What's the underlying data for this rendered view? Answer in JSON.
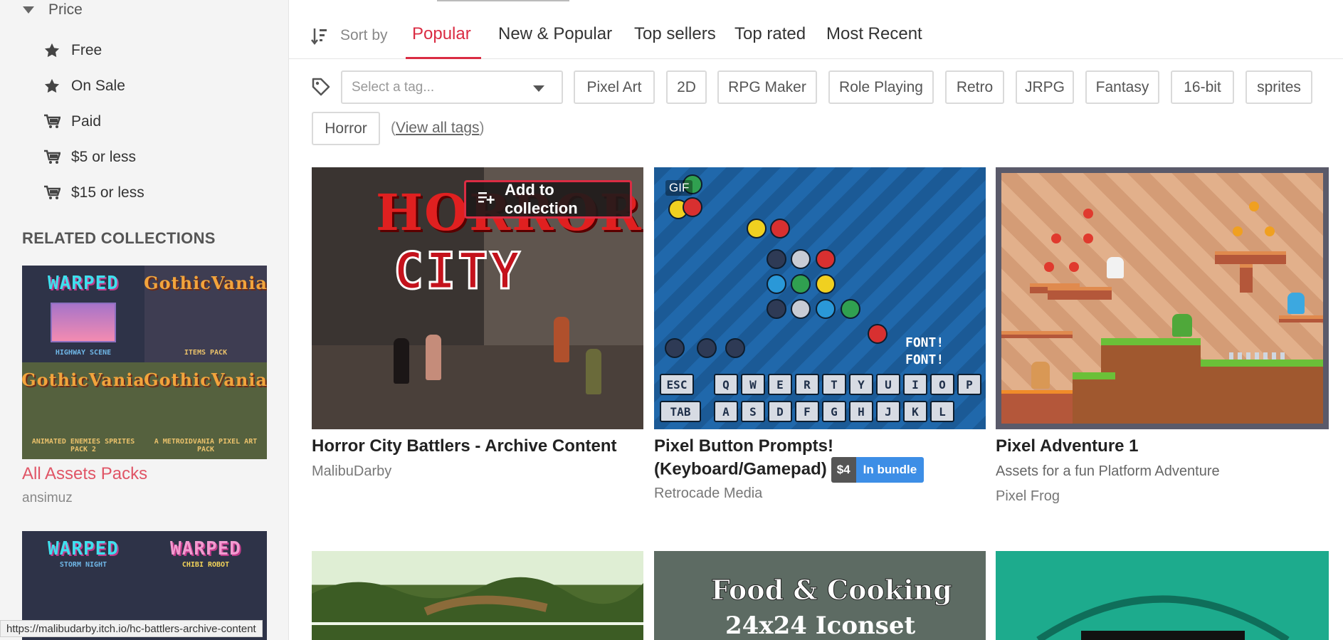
{
  "sidebar": {
    "price_heading": "Price",
    "price_filters": [
      {
        "label": "Free",
        "icon": "star-icon"
      },
      {
        "label": "On Sale",
        "icon": "star-icon"
      },
      {
        "label": "Paid",
        "icon": "cart-icon"
      },
      {
        "label": "$5 or less",
        "icon": "cart-icon"
      },
      {
        "label": "$15 or less",
        "icon": "cart-icon"
      }
    ],
    "related_heading": "RELATED COLLECTIONS",
    "collection": {
      "title": "All Assets Packs",
      "user": "ansimuz",
      "thumbs": [
        {
          "logo": "WARPED",
          "sub": "HIGHWAY SCENE"
        },
        {
          "logo": "GothicVania",
          "sub": "ITEMS PACK"
        },
        {
          "logo": "GothicVania",
          "sub": "ANIMATED ENEMIES SPRITES PACK 2"
        },
        {
          "logo": "GothicVania",
          "sub": "A METROIDVANIA PIXEL ART PACK"
        }
      ]
    },
    "collection2_thumbs": [
      {
        "logo": "WARPED",
        "sub": "STORM NIGHT"
      },
      {
        "logo": "WARPED",
        "sub": "CHIBI ROBOT"
      }
    ]
  },
  "sort": {
    "label": "Sort by",
    "tabs": [
      "Popular",
      "New & Popular",
      "Top sellers",
      "Top rated",
      "Most Recent"
    ],
    "active": "Popular"
  },
  "tags": {
    "placeholder": "Select a tag...",
    "items": [
      "Pixel Art",
      "2D",
      "RPG Maker",
      "Role Playing",
      "Retro",
      "JRPG",
      "Fantasy",
      "16-bit",
      "sprites",
      "Horror"
    ],
    "view_all_open": "(",
    "view_all": "View all tags",
    "view_all_close": ")"
  },
  "games": [
    {
      "title": "Horror City Battlers - Archive Content",
      "author": "MalibuDarby",
      "cover_text_1": "HORROR",
      "cover_text_2": "CITY",
      "add_to_collection": "Add to collection"
    },
    {
      "title_line1": "Pixel Button Prompts!",
      "title_line2": "(Keyboard/Gamepad)",
      "price": "$4",
      "bundle": "In bundle",
      "author": "Retrocade Media",
      "gif_label": "GIF",
      "font_text_1": "FONT!",
      "font_text_2": "FONT!"
    },
    {
      "title": "Pixel Adventure 1",
      "description": "Assets for a fun Platform Adventure",
      "author": "Pixel Frog"
    },
    {
      "title": ""
    },
    {
      "cover_text_1": "Food & Cooking",
      "cover_text_2": "24x24 Iconset"
    },
    {
      "title": ""
    }
  ],
  "status_url": "https://malibudarby.itch.io/hc-battlers-archive-content",
  "colors": {
    "accent": "#da2c43",
    "link_pink": "#e05566",
    "bundle_blue": "#3d8ee6"
  }
}
